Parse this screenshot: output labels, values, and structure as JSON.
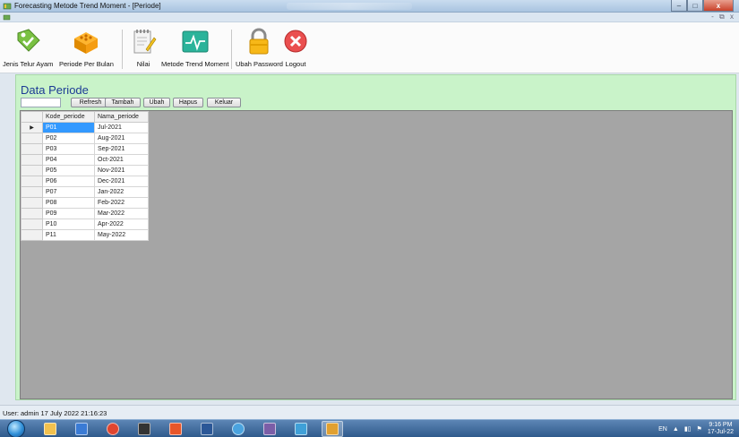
{
  "window": {
    "title": "Forecasting Metode Trend Moment - [Periode]",
    "controls": {
      "min": "‒",
      "max": "□",
      "close": "x"
    },
    "mdi_controls": "- ⧉ x"
  },
  "toolbar": {
    "items": [
      {
        "label": "Jenis Telur Ayam",
        "icon": "tag-icon"
      },
      {
        "label": "Periode Per Bulan",
        "icon": "box-icon"
      },
      {
        "label": "Nilai",
        "icon": "notepad-icon"
      },
      {
        "label": "Metode Trend Moment",
        "icon": "pulse-chart-icon"
      },
      {
        "label": "Ubah Password",
        "icon": "lock-icon"
      },
      {
        "label": "Logout",
        "icon": "close-circle-icon"
      }
    ]
  },
  "form": {
    "title": "Data Periode",
    "search": {
      "value": "",
      "placeholder": ""
    },
    "buttons": {
      "refresh": "Refresh",
      "tambah": "Tambah",
      "ubah": "Ubah",
      "hapus": "Hapus",
      "keluar": "Keluar"
    }
  },
  "grid": {
    "columns": [
      "Kode_periode",
      "Nama_periode"
    ],
    "current_row_marker": "▶",
    "rows": [
      [
        "P01",
        "Jul-2021"
      ],
      [
        "P02",
        "Aug-2021"
      ],
      [
        "P03",
        "Sep-2021"
      ],
      [
        "P04",
        "Oct-2021"
      ],
      [
        "P05",
        "Nov-2021"
      ],
      [
        "P06",
        "Dec-2021"
      ],
      [
        "P07",
        "Jan-2022"
      ],
      [
        "P08",
        "Feb-2022"
      ],
      [
        "P09",
        "Mar-2022"
      ],
      [
        "P10",
        "Apr-2022"
      ],
      [
        "P11",
        "May-2022"
      ]
    ],
    "selected_row": 0
  },
  "status": {
    "text": "User: admin  17 July 2022 21:16:23"
  },
  "taskbar": {
    "apps": [
      "explorer-icon",
      "box-app-icon",
      "chrome-icon",
      "terminal-icon",
      "codeblocks-icon",
      "office-icon",
      "browser-icon",
      "vs-icon",
      "network-icon",
      "forecast-app-icon"
    ],
    "tray": {
      "lang": "EN",
      "time": "9:16 PM",
      "date": "17-Jul-22"
    }
  },
  "colors": {
    "form_background": "#c9f3c9",
    "title_color": "#1c3a95",
    "selection": "#3399ff",
    "grid_background": "#a5a5a5"
  }
}
